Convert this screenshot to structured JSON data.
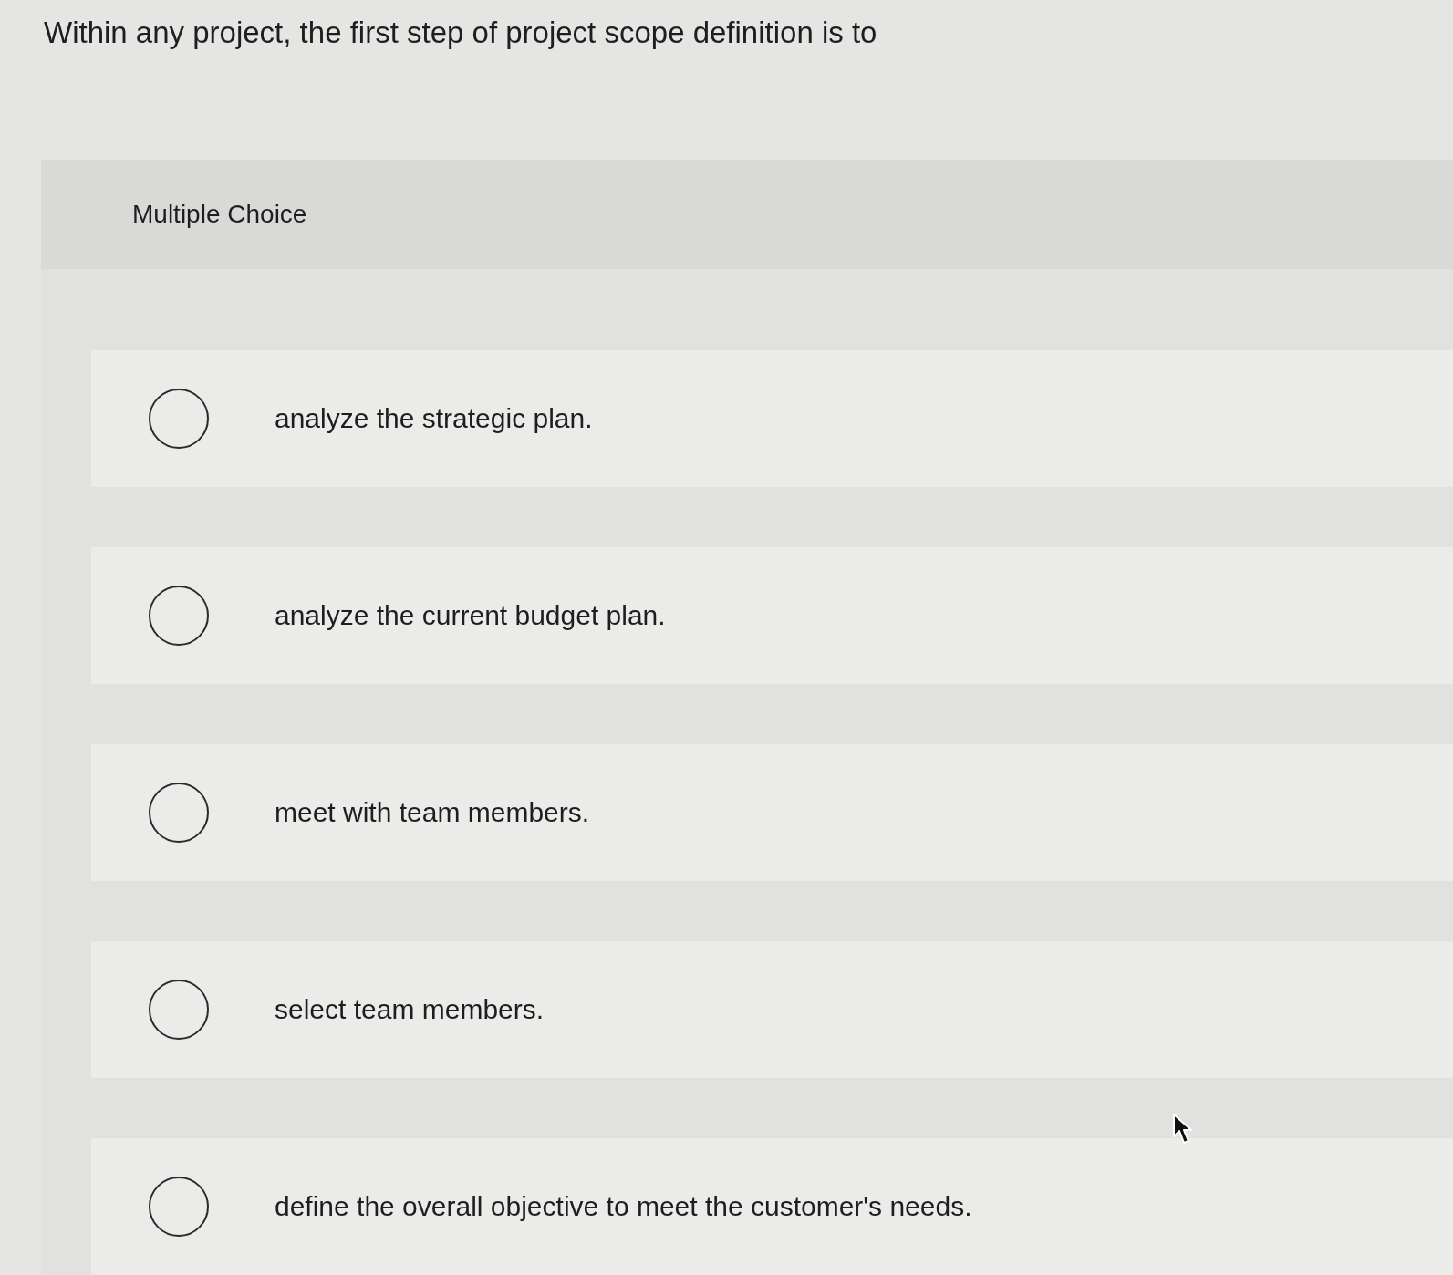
{
  "question": {
    "text": "Within any project, the first step of project scope definition is to"
  },
  "panel": {
    "type_label": "Multiple Choice",
    "options": [
      {
        "text": "analyze the strategic plan.",
        "selected": false
      },
      {
        "text": "analyze the current budget plan.",
        "selected": false
      },
      {
        "text": "meet with team members.",
        "selected": false
      },
      {
        "text": "select team members.",
        "selected": false
      },
      {
        "text": "define the overall objective to meet the customer's needs.",
        "selected": false
      }
    ]
  }
}
